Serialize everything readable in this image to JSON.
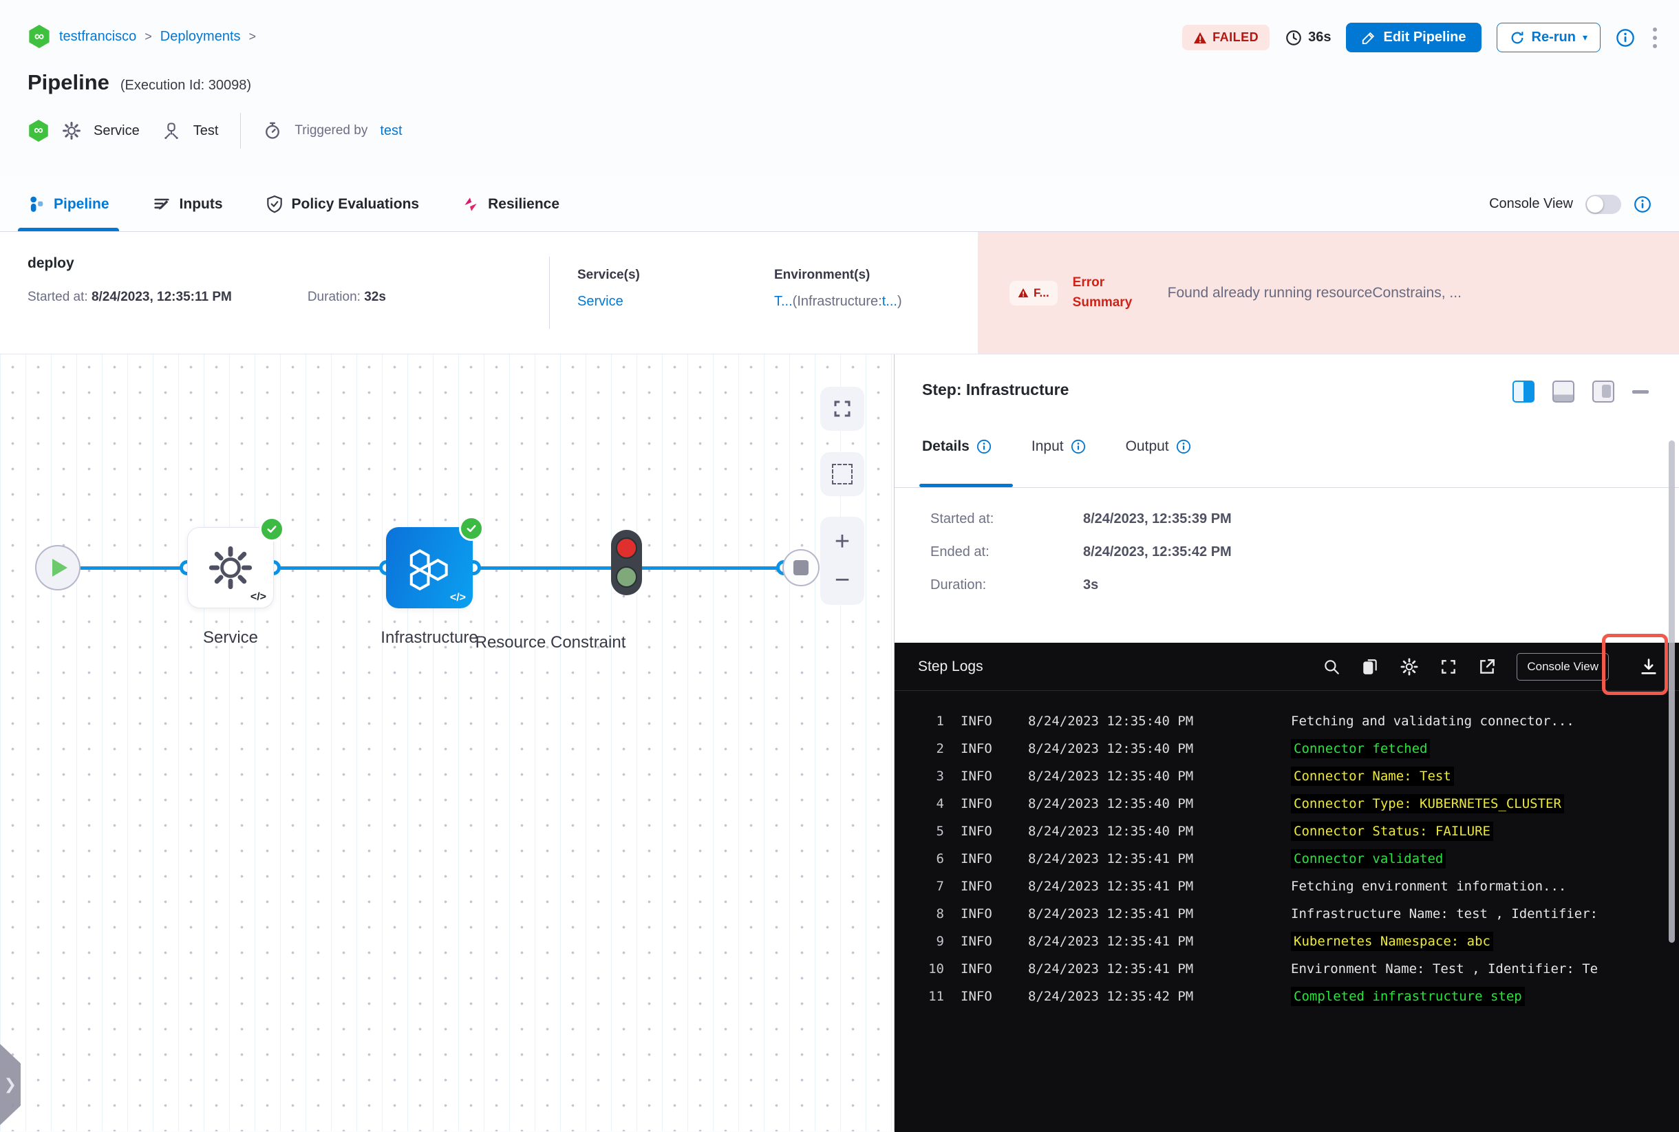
{
  "header": {
    "breadcrumb": {
      "project": "testfrancisco",
      "sep1": ">",
      "section": "Deployments",
      "sep2": ">"
    },
    "title": "Pipeline",
    "execution_id": "(Execution Id: 30098)",
    "status_badge": "FAILED",
    "total_duration": "36s",
    "edit_pipeline_label": "Edit Pipeline",
    "rerun_label": "Re-run",
    "service_label": "Service",
    "environment_label": "Test",
    "triggered_by_label": "Triggered by",
    "trigger_user": "test"
  },
  "tabs": {
    "items": [
      {
        "label": "Pipeline",
        "active": true
      },
      {
        "label": "Inputs",
        "active": false
      },
      {
        "label": "Policy Evaluations",
        "active": false
      },
      {
        "label": "Resilience",
        "active": false
      }
    ],
    "console_view_label": "Console View"
  },
  "summary": {
    "stage_name": "deploy",
    "started_label": "Started at:",
    "started_value": "8/24/2023, 12:35:11 PM",
    "duration_label": "Duration:",
    "duration_value": "32s",
    "services_header": "Service(s)",
    "service_link": "Service",
    "environments_header": "Environment(s)",
    "env_part1": "T...",
    "env_part2": "(Infrastructure:",
    "env_part3": "t...",
    "env_part4": ")",
    "error_chip": "F...",
    "error_label": "Error Summary",
    "error_message": "Found already running resourceConstrains, ..."
  },
  "canvas": {
    "nodes": [
      {
        "label": "Service"
      },
      {
        "label": "Infrastructure"
      },
      {
        "label": "Resource Constraint"
      }
    ],
    "code_glyph": "</>",
    "zoom_in": "+",
    "zoom_out": "−"
  },
  "panel": {
    "title": "Step: Infrastructure",
    "tabs": [
      {
        "label": "Details"
      },
      {
        "label": "Input"
      },
      {
        "label": "Output"
      }
    ],
    "details": [
      {
        "label": "Started at:",
        "value": "8/24/2023, 12:35:39 PM"
      },
      {
        "label": "Ended at:",
        "value": "8/24/2023, 12:35:42 PM"
      },
      {
        "label": "Duration:",
        "value": "3s"
      }
    ]
  },
  "logs": {
    "title": "Step Logs",
    "console_view_label": "Console View",
    "lines": [
      {
        "n": 1,
        "level": "INFO",
        "time": "8/24/2023 12:35:40 PM",
        "msg": "Fetching and validating connector...",
        "color": "white"
      },
      {
        "n": 2,
        "level": "INFO",
        "time": "8/24/2023 12:35:40 PM",
        "msg": "Connector fetched",
        "color": "green"
      },
      {
        "n": 3,
        "level": "INFO",
        "time": "8/24/2023 12:35:40 PM",
        "msg": "Connector Name: Test",
        "color": "yellow"
      },
      {
        "n": 4,
        "level": "INFO",
        "time": "8/24/2023 12:35:40 PM",
        "msg": "Connector Type: KUBERNETES_CLUSTER",
        "color": "yellow"
      },
      {
        "n": 5,
        "level": "INFO",
        "time": "8/24/2023 12:35:40 PM",
        "msg": "Connector Status: FAILURE",
        "color": "yellow"
      },
      {
        "n": 6,
        "level": "INFO",
        "time": "8/24/2023 12:35:41 PM",
        "msg": "Connector validated",
        "color": "green"
      },
      {
        "n": 7,
        "level": "INFO",
        "time": "8/24/2023 12:35:41 PM",
        "msg": "Fetching environment information...",
        "color": "white"
      },
      {
        "n": 8,
        "level": "INFO",
        "time": "8/24/2023 12:35:41 PM",
        "msg": "Infrastructure Name: test , Identifier:",
        "color": "white"
      },
      {
        "n": 9,
        "level": "INFO",
        "time": "8/24/2023 12:35:41 PM",
        "msg": "Kubernetes Namespace: abc",
        "color": "yellow"
      },
      {
        "n": 10,
        "level": "INFO",
        "time": "8/24/2023 12:35:41 PM",
        "msg": "Environment Name: Test , Identifier: Te",
        "color": "white"
      },
      {
        "n": 11,
        "level": "INFO",
        "time": "8/24/2023 12:35:42 PM",
        "msg": "Completed infrastructure step",
        "color": "green"
      }
    ]
  },
  "icons": {
    "infinity_glyph": "∞",
    "kebab_glyph": "⋮",
    "caret_glyph": "▾",
    "chevron_glyph": "❯"
  },
  "colors": {
    "primary_blue": "#0278d5",
    "node_blue": "#0b93e8",
    "failed_red": "#b41710",
    "error_bg": "#fbe5e2",
    "success_green": "#3cba44",
    "log_green": "#2fe042",
    "log_yellow": "#ede93a",
    "highlight_red": "#f3594a"
  }
}
